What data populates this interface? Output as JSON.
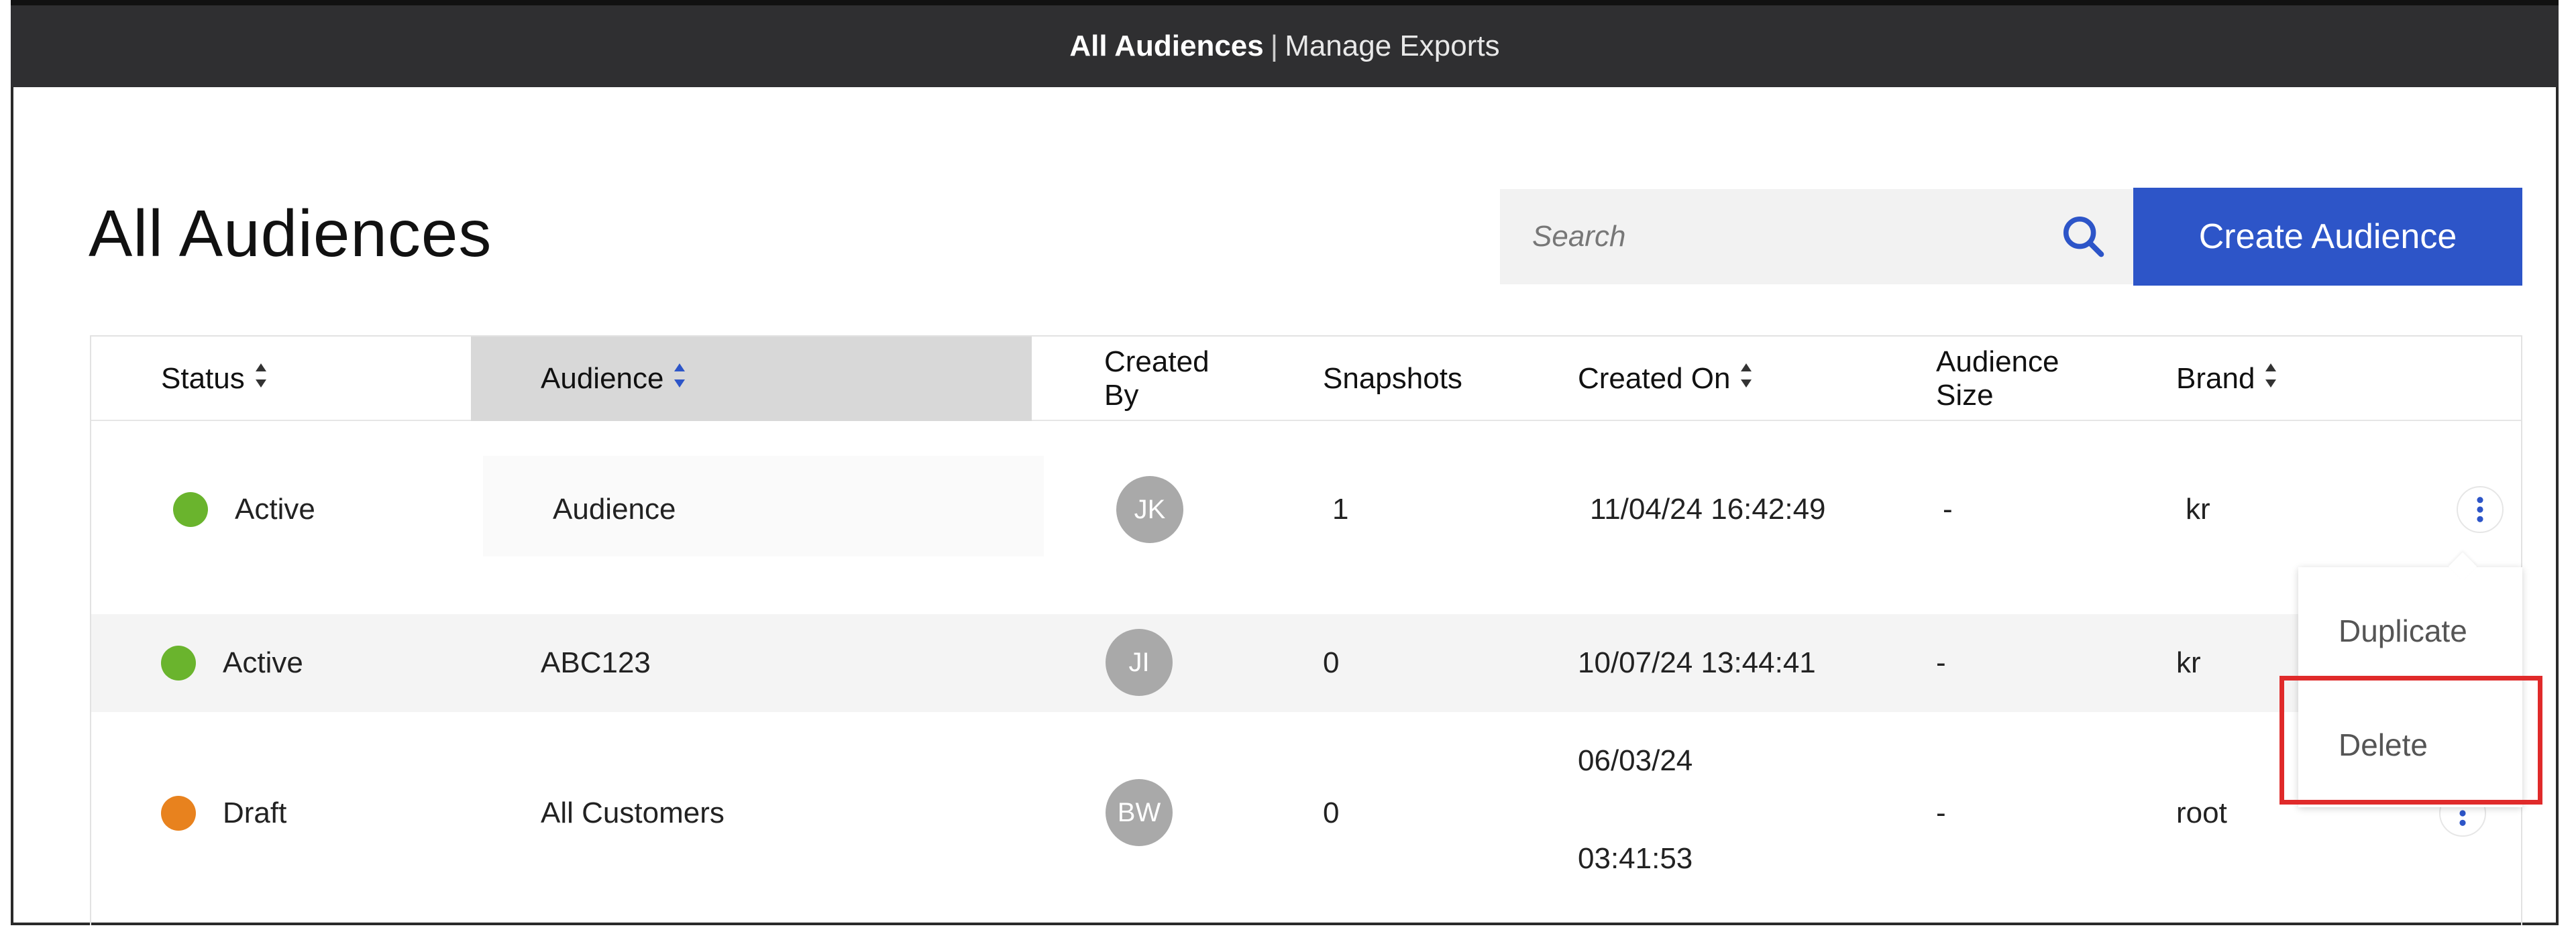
{
  "topbar": {
    "all_audiences": "All Audiences",
    "separator": "|",
    "manage_exports": "Manage Exports"
  },
  "page": {
    "title": "All Audiences"
  },
  "search": {
    "placeholder": "Search",
    "icon": "search-icon"
  },
  "create_button": {
    "label": "Create Audience"
  },
  "table": {
    "columns": [
      {
        "label": "Status",
        "sortable": true
      },
      {
        "label": "Audience",
        "sortable": true,
        "active": true
      },
      {
        "label": "Created By",
        "sortable": false
      },
      {
        "label": "Snapshots",
        "sortable": false
      },
      {
        "label": "Created On",
        "sortable": true
      },
      {
        "label": "Audience Size",
        "sortable": false
      },
      {
        "label": "Brand",
        "sortable": true
      }
    ],
    "created_by_l1": "Created",
    "created_by_l2": "By",
    "audience_size_l1": "Audience",
    "audience_size_l2": "Size",
    "rows": [
      {
        "status": "Active",
        "status_color": "#6ab42d",
        "audience": "Audience",
        "created_by": "JK",
        "snapshots": "1",
        "created_on": "11/04/24 16:42:49",
        "audience_size": "-",
        "brand": "kr"
      },
      {
        "status": "Active",
        "status_color": "#6ab42d",
        "audience": "ABC123",
        "created_by": "JI",
        "snapshots": "0",
        "created_on": "10/07/24 13:44:41",
        "audience_size": "-",
        "brand": "kr"
      },
      {
        "status": "Draft",
        "status_color": "#e8821e",
        "audience": "All Customers",
        "created_by": "BW",
        "snapshots": "0",
        "created_on_date": "06/03/24",
        "created_on_time": "03:41:53",
        "audience_size": "-",
        "brand": "root"
      }
    ]
  },
  "row_menu": {
    "duplicate": "Duplicate",
    "delete": "Delete"
  },
  "colors": {
    "accent": "#2d55c8",
    "topbar": "#2f2f31",
    "highlight": "#e02a2a"
  }
}
